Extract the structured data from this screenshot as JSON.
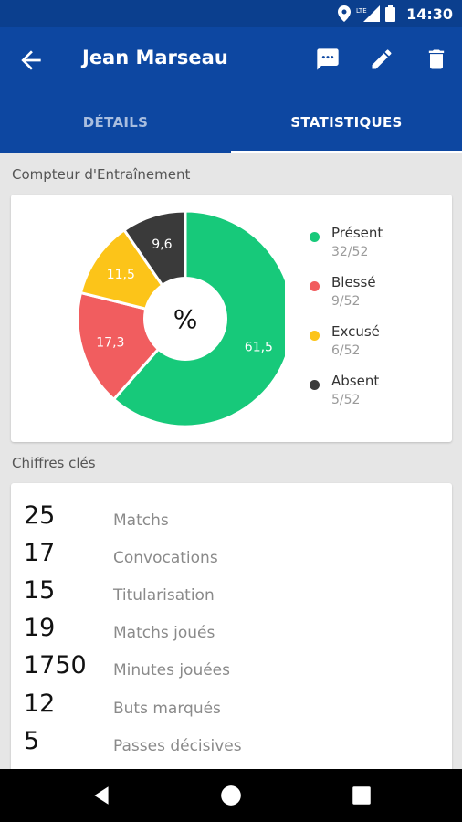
{
  "status_bar": {
    "time": "14:30"
  },
  "app_bar": {
    "title": "Jean Marseau",
    "icons": [
      "back-arrow-icon",
      "message-icon",
      "edit-icon",
      "delete-icon"
    ]
  },
  "tabs": [
    {
      "label": "DÉTAILS",
      "active": false
    },
    {
      "label": "STATISTIQUES",
      "active": true
    }
  ],
  "training": {
    "section_title": "Compteur d'Entraînement",
    "center_label": "%",
    "chart_data": {
      "type": "pie",
      "title": "",
      "slices": [
        {
          "name": "Présent",
          "value": 61.5,
          "label": "61,5",
          "color": "#17c97a"
        },
        {
          "name": "Blessé",
          "value": 17.3,
          "label": "17,3",
          "color": "#f15d5f"
        },
        {
          "name": "Excusé",
          "value": 11.5,
          "label": "11,5",
          "color": "#fcc419"
        },
        {
          "name": "Absent",
          "value": 9.6,
          "label": "9,6",
          "color": "#3a3a3a"
        }
      ]
    },
    "legend": [
      {
        "label": "Présent",
        "count": "32/52",
        "color": "#17c97a"
      },
      {
        "label": "Blessé",
        "count": "9/52",
        "color": "#f15d5f"
      },
      {
        "label": "Excusé",
        "count": "6/52",
        "color": "#fcc419"
      },
      {
        "label": "Absent",
        "count": "5/52",
        "color": "#3a3a3a"
      }
    ]
  },
  "key_figures": {
    "section_title": "Chiffres clés",
    "rows": [
      {
        "value": "25",
        "label": "Matchs"
      },
      {
        "value": "17",
        "label": "Convocations"
      },
      {
        "value": "15",
        "label": "Titularisation"
      },
      {
        "value": "19",
        "label": "Matchs joués"
      },
      {
        "value": "1750",
        "label": "Minutes jouées"
      },
      {
        "value": "12",
        "label": "Buts marqués"
      },
      {
        "value": "5",
        "label": "Passes décisives"
      }
    ]
  },
  "colors": {
    "primary": "#0d47a1",
    "status_bar": "#0b3f8e"
  }
}
